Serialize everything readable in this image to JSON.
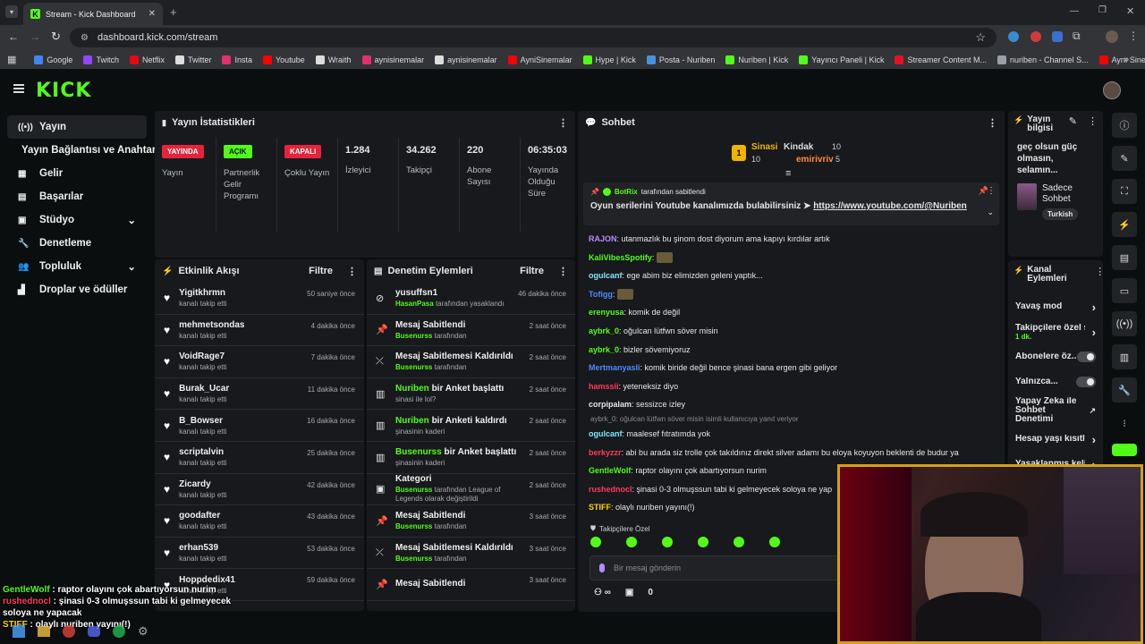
{
  "browser": {
    "tab_title": "Stream - Kick Dashboard",
    "url": "dashboard.kick.com/stream",
    "bookmarks": [
      {
        "label": "Google",
        "color": "#4285f4"
      },
      {
        "label": "Twitch",
        "color": "#9146ff"
      },
      {
        "label": "Netflix",
        "color": "#e50914"
      },
      {
        "label": "Twitter",
        "color": "#dddddd"
      },
      {
        "label": "Insta",
        "color": "#e1306c"
      },
      {
        "label": "Youtube",
        "color": "#ff0000"
      },
      {
        "label": "Wraith",
        "color": "#dddddd"
      },
      {
        "label": "aynisinemalar",
        "color": "#e1306c"
      },
      {
        "label": "aynisinemalar",
        "color": "#dddddd"
      },
      {
        "label": "AyniSinemalar",
        "color": "#ff0000"
      },
      {
        "label": "Hype | Kick",
        "color": "#53fc18"
      },
      {
        "label": "Posta - Nuriben",
        "color": "#4a90e2"
      },
      {
        "label": "Nuriben | Kick",
        "color": "#53fc18"
      },
      {
        "label": "Yayıncı Paneli | Kick",
        "color": "#53fc18"
      },
      {
        "label": "Streamer Content M...",
        "color": "#e81123"
      },
      {
        "label": "nuriben - Channel S...",
        "color": "#9aa0a6"
      },
      {
        "label": "Aynı Sinemalar - Ça...",
        "color": "#ff0000"
      }
    ]
  },
  "sidebar": {
    "items": [
      {
        "label": "Yayın",
        "icon": "broadcast-icon"
      },
      {
        "label": "Yayın Bağlantısı ve Anahtarı",
        "icon": ""
      },
      {
        "label": "Gelir",
        "icon": "revenue-icon"
      },
      {
        "label": "Başarılar",
        "icon": "achievements-icon"
      },
      {
        "label": "Stüdyo",
        "icon": "studio-icon"
      },
      {
        "label": "Denetleme",
        "icon": "wrench-icon"
      },
      {
        "label": "Topluluk",
        "icon": "community-icon"
      },
      {
        "label": "Droplar ve ödüller",
        "icon": "drops-icon"
      }
    ]
  },
  "stats": {
    "title": "Yayın İstatistikleri",
    "cards": [
      {
        "badge": "YAYINDA",
        "badge_color": "#e5243b",
        "label": "Yayın"
      },
      {
        "badge": "AÇIK",
        "badge_color": "#53fc18",
        "label": "Partnerlik Gelir Programı"
      },
      {
        "badge": "KAPALI",
        "badge_color": "#e5243b",
        "label": "Çoklu Yayın"
      },
      {
        "value": "1.284",
        "label": "İzleyici"
      },
      {
        "value": "34.262",
        "label": "Takipçi"
      },
      {
        "value": "220",
        "label": "Abone Sayısı"
      },
      {
        "value": "06:35:03",
        "label": "Yayında Olduğu Süre"
      }
    ]
  },
  "activity": {
    "title": "Etkinlik Akışı",
    "filter": "Filtre",
    "items": [
      {
        "name": "Yigitkhrmn",
        "sub": "kanalı takip etti",
        "time": "50 saniye önce"
      },
      {
        "name": "mehmetsondas",
        "sub": "kanalı takip etti",
        "time": "4 dakika önce"
      },
      {
        "name": "VoidRage7",
        "sub": "kanalı takip etti",
        "time": "7 dakika önce"
      },
      {
        "name": "Burak_Ucar",
        "sub": "kanalı takip etti",
        "time": "11 dakika önce"
      },
      {
        "name": "B_Bowser",
        "sub": "kanalı takip etti",
        "time": "16 dakika önce"
      },
      {
        "name": "scriptalvin",
        "sub": "kanalı takip etti",
        "time": "25 dakika önce"
      },
      {
        "name": "Zicardy",
        "sub": "kanalı takip etti",
        "time": "42 dakika önce"
      },
      {
        "name": "goodafter",
        "sub": "kanalı takip etti",
        "time": "43 dakika önce"
      },
      {
        "name": "erhan539",
        "sub": "kanalı takip etti",
        "time": "53 dakika önce"
      },
      {
        "name": "Hoppdedix41",
        "sub": "kanalı takip etti",
        "time": "59 dakika önce"
      }
    ]
  },
  "moderation": {
    "title": "Denetim Eylemleri",
    "filter": "Filtre",
    "items": [
      {
        "icon": "ban-icon",
        "name": "yusuffsn1",
        "sub_user": "HasanPasa",
        "sub": "tarafından yasaklandı",
        "time": "46 dakika önce"
      },
      {
        "icon": "pin-icon",
        "name": "Mesaj Sabitlendi",
        "sub_user": "Busenurss",
        "sub": "tarafından",
        "time": "2 saat önce"
      },
      {
        "icon": "unpin-icon",
        "name": "Mesaj Sabitlemesi Kaldırıldı",
        "sub_user": "Busenurss",
        "sub": "tarafından",
        "time": "2 saat önce"
      },
      {
        "icon": "poll-icon",
        "name_user": "Nuriben",
        "name": "bir Anket başlattı",
        "sub_user": "",
        "sub": "sinasi ile lol?",
        "time": "2 saat önce"
      },
      {
        "icon": "poll-icon",
        "name_user": "Nuriben",
        "name": "bir Anketi kaldırdı",
        "sub_user": "",
        "sub": "şinasinin kaderi",
        "time": "2 saat önce"
      },
      {
        "icon": "poll-icon",
        "name_user": "Busenurss",
        "name": "bir Anket başlattı",
        "sub_user": "",
        "sub": "şinasinin kaderi",
        "time": "2 saat önce"
      },
      {
        "icon": "category-icon",
        "name": "Kategori",
        "sub_user": "Busenurss",
        "sub": "tarafından League of Legends olarak değiştirildi",
        "time": "2 saat önce"
      },
      {
        "icon": "pin-icon",
        "name": "Mesaj Sabitlendi",
        "sub_user": "Busenurss",
        "sub": "tarafından",
        "time": "3 saat önce"
      },
      {
        "icon": "unpin-icon",
        "name": "Mesaj Sabitlemesi Kaldırıldı",
        "sub_user": "Busenurss",
        "sub": "tarafından",
        "time": "3 saat önce"
      },
      {
        "icon": "pin-icon",
        "name": "Mesaj Sabitlendi",
        "sub_user": "",
        "sub": "",
        "time": "3 saat önce"
      }
    ]
  },
  "chat": {
    "title": "Sohbet",
    "leaderboard": [
      {
        "name": "Sinasi",
        "count": "10",
        "rank": "1"
      },
      {
        "name": "Kindak",
        "count": "10"
      },
      {
        "name": "emirivriv",
        "count": "5"
      }
    ],
    "pinned": {
      "by": "BotRix",
      "by_suffix": "tarafından sabitlendi",
      "text": "Oyun serilerini Youtube kanalımızda bulabilirsiniz ➤ ",
      "link": "https://www.youtube.com/@Nuriben"
    },
    "messages": [
      {
        "user": "RAJON",
        "color": "#b58cff",
        "text": "utanmazlık bu şinom dost diyorum ama kapıyı kırdılar artık"
      },
      {
        "user": "KaliVibesSpotify",
        "color": "#53fc18",
        "text": ""
      },
      {
        "user": "ogulcanf",
        "color": "#7ee8fa",
        "text": "ege abim biz elimizden geleni yaptık..."
      },
      {
        "user": "Tofigg",
        "color": "#4b8bff",
        "text": ""
      },
      {
        "user": "erenyusa",
        "color": "#53fc18",
        "text": "komik de değil"
      },
      {
        "user": "aybrk_0",
        "color": "#53fc18",
        "text": "oğulcan lütfwn söver misin"
      },
      {
        "user": "aybrk_0",
        "color": "#53fc18",
        "text": "bizler sövemiyoruz"
      },
      {
        "user": "Mertmanyasli",
        "color": "#4b8bff",
        "text": "komik biride değil bence şinasi bana ergen gibi geliyor"
      },
      {
        "user": "hamssii",
        "color": "#ff3b5c",
        "text": "yeteneksiz diyo"
      },
      {
        "user": "corpipalam",
        "color": "#e6e6e6",
        "text": "sessizce izley"
      },
      {
        "reply": "aybrk_0: oğulcan lütfwn söver misin isimli kullanıcıya yanıt veriyor",
        "user": "ogulcanf",
        "color": "#7ee8fa",
        "text": "maalesef fıtratımda yok"
      },
      {
        "user": "berkyzzr",
        "color": "#ff3b5c",
        "text": "abi bu arada siz trolle çok takıldınız direkt silver adamı bu eloya koyuyon beklenti de budur ya"
      },
      {
        "user": "GentleWolf",
        "color": "#53fc18",
        "text": "raptor olayını çok abartıyorsun nurim"
      },
      {
        "user": "rushednocl",
        "color": "#ff3b5c",
        "text": "şinasi 0-3 olmuşssun tabi ki gelmeyecek soloya ne yap"
      },
      {
        "user": "STIFF",
        "color": "#ffd400",
        "text": "olaylı nuriben yayını(!)"
      }
    ],
    "followers_only": "Takipçilere Özel",
    "input_placeholder": "Bir mesaj gönderin",
    "points": "0"
  },
  "stream_info": {
    "title": "Yayın bilgisi",
    "stream_title": "geç olsun güç olmasın, selamın...",
    "category": "Sadece Sohbet",
    "tag": "Turkish"
  },
  "channel_actions": {
    "title": "Kanal Eylemleri",
    "items": [
      {
        "label": "Yavaş mod",
        "type": "arrow"
      },
      {
        "label": "Takipçilere özel s",
        "sub": "1 dk.",
        "type": "arrow"
      },
      {
        "label": "Abonelere öz...",
        "type": "toggle"
      },
      {
        "label": "Yalnızca...",
        "type": "toggle"
      },
      {
        "label": "Yapay Zeka ile Sohbet Denetimi",
        "type": "external"
      },
      {
        "label": "Hesap yaşı kısıtla",
        "type": "arrow"
      },
      {
        "label": "Yasaklanmış kelin",
        "type": "arrow"
      }
    ]
  },
  "overlay": {
    "lines": [
      {
        "user": "GentleWolf",
        "color": "#53fc18",
        "text": " : raptor olayını çok abartıyorsun nurim"
      },
      {
        "user": "rushednocl",
        "color": "#ff3b5c",
        "text": " : şinasi 0-3 olmuşssun tabi ki gelmeyecek"
      },
      {
        "user": "",
        "color": "#ffffff",
        "text": "soloya ne yapacak"
      },
      {
        "user": "STIFF",
        "color": "#ffd400",
        "text": " : olaylı nuriben yayını(!)"
      }
    ]
  }
}
